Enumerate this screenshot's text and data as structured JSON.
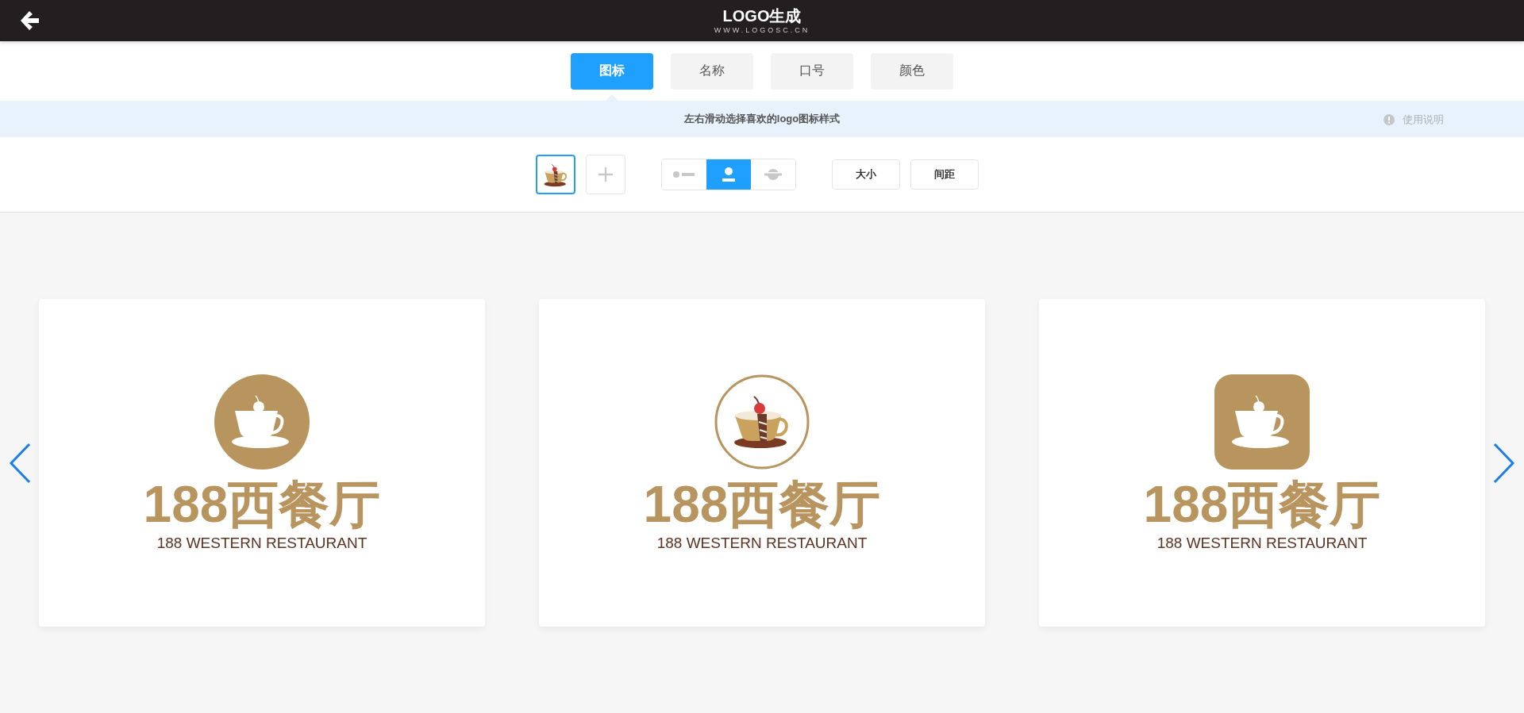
{
  "header": {
    "logo_text": "LOGO生成",
    "logo_url": "WWW.LOGOSC.CN"
  },
  "tabs": [
    {
      "label": "图标",
      "selected": true
    },
    {
      "label": "名称",
      "selected": false
    },
    {
      "label": "口号",
      "selected": false
    },
    {
      "label": "颜色",
      "selected": false
    }
  ],
  "hint_bar": {
    "text": "左右滑动选择喜欢的logo图标样式",
    "help": "使用说明"
  },
  "toolbar": {
    "icon_slot": {
      "selected": true
    },
    "layouts": [
      {
        "kind": "icon-left",
        "selected": false
      },
      {
        "kind": "icon-top",
        "selected": true
      },
      {
        "kind": "icon-behind",
        "selected": false
      }
    ],
    "buttons": [
      "大小",
      "间距"
    ]
  },
  "cards": [
    {
      "kind": "circle-filled",
      "name": "188西餐厅",
      "subtitle": "188 WESTERN RESTAURANT"
    },
    {
      "kind": "circle-outline",
      "name": "188西餐厅",
      "subtitle": "188 WESTERN RESTAURANT"
    },
    {
      "kind": "rounded-square",
      "name": "188西餐厅",
      "subtitle": "188 WESTERN RESTAURANT"
    }
  ]
}
